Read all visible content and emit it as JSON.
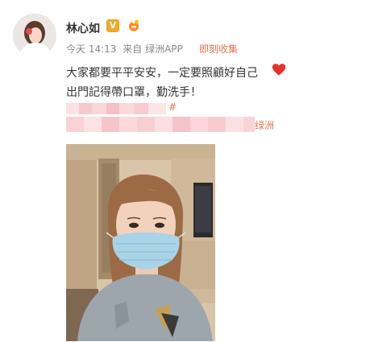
{
  "post": {
    "username": "林心如",
    "vip_badge": "V",
    "time": "今天 14:13",
    "source_prefix": "来自",
    "source_app": "绿洲APP",
    "collect_action": "即刻收集",
    "line1": "大家都要平平安安，一定要照顧好自己",
    "line2": "出門記得帶口罩，勤洗手！",
    "hashtag_visible_fragment": "#",
    "link_tail_fragment": "绿洲"
  },
  "icons": {
    "vip": "vip-verified-icon",
    "fans": "fan-badge-icon",
    "heart": "red-heart-emoji",
    "avatar": "user-avatar"
  },
  "colors": {
    "accent": "#eb7350",
    "text": "#333333",
    "meta": "#888888",
    "vip": "#f5a623",
    "heart": "#e8302c"
  }
}
